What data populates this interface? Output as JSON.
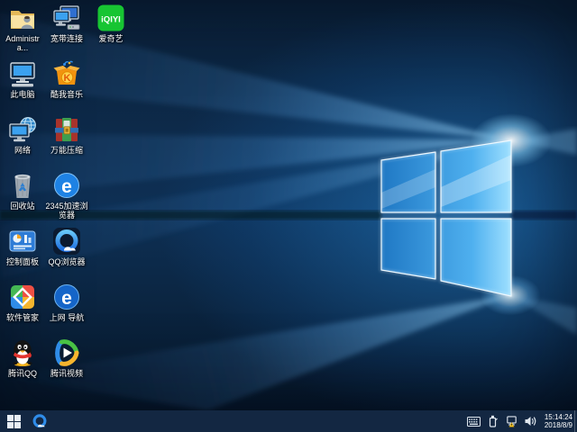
{
  "wallpaper": {
    "description": "Windows 10 hero wallpaper, glowing window logo",
    "base_top": "#0a2038",
    "base_mid": "#0e3055",
    "base_bottom": "#061527",
    "glow_blue": "#35a3f5",
    "logo_edge": "#eaf7ff"
  },
  "desktop": {
    "icons": [
      {
        "name": "user-folder",
        "label": "Administra..."
      },
      {
        "name": "this-pc",
        "label": "此电脑"
      },
      {
        "name": "network",
        "label": "网络"
      },
      {
        "name": "recycle-bin",
        "label": "回收站"
      },
      {
        "name": "control-panel",
        "label": "控制面板"
      },
      {
        "name": "software-manager",
        "label": "软件管家"
      },
      {
        "name": "tencent-qq",
        "label": "腾讯QQ"
      },
      {
        "name": "broadband-connection",
        "label": "宽带连接"
      },
      {
        "name": "kuwo-music",
        "label": "酷我音乐"
      },
      {
        "name": "universal-archiver",
        "label": "万能压缩"
      },
      {
        "name": "2345-speed-browser",
        "label": "2345加速浏览器"
      },
      {
        "name": "qq-browser",
        "label": "QQ浏览器"
      },
      {
        "name": "web-navigation",
        "label": "上网 导航"
      },
      {
        "name": "tencent-video",
        "label": "腾讯视频"
      },
      {
        "name": "iqiyi",
        "label": "爱奇艺",
        "logo_text": "iQIYI"
      }
    ]
  },
  "taskbar": {
    "color": "#132742",
    "start_button": "start",
    "pinned": [
      {
        "name": "qq-browser"
      }
    ],
    "tray_icons": [
      "touch-keyboard",
      "usb-device",
      "network-warning",
      "volume"
    ],
    "clock": {
      "time": "15:14:24",
      "date": "2018/8/9"
    }
  }
}
